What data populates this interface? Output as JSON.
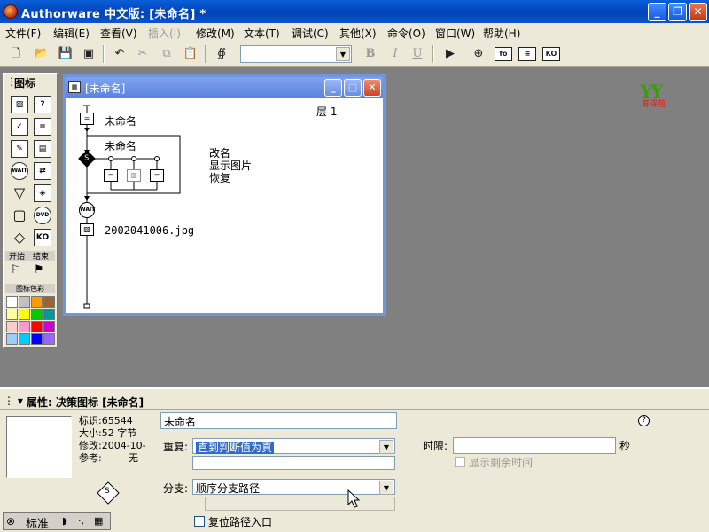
{
  "window": {
    "title": "Authorware 中文版: [未命名] *"
  },
  "menu": [
    "文件(F)",
    "编辑(E)",
    "查看(V)",
    "插入(I)",
    "修改(M)",
    "文本(T)",
    "调试(C)",
    "其他(X)",
    "命令(O)",
    "窗口(W)",
    "帮助(H)"
  ],
  "toolbar": {
    "font_value": "",
    "bold": "B",
    "italic": "I",
    "underline": "U",
    "logo_text": "YY",
    "logo_sub": "育碟苑"
  },
  "palette": {
    "title": "图标",
    "icons": [
      {
        "name": "display-icon",
        "glyph": "▨"
      },
      {
        "name": "motion-icon",
        "glyph": "?"
      },
      {
        "name": "erase-icon",
        "glyph": "✓"
      },
      {
        "name": "wait-icon",
        "glyph": "="
      },
      {
        "name": "navigate-icon",
        "glyph": "✎"
      },
      {
        "name": "framework-icon",
        "glyph": "▤"
      },
      {
        "name": "decision-icon",
        "glyph": "WAIT"
      },
      {
        "name": "interaction-icon",
        "glyph": "⇄"
      },
      {
        "name": "calculation-icon",
        "glyph": "▽"
      },
      {
        "name": "map-icon",
        "glyph": "◈"
      },
      {
        "name": "digital-movie-icon",
        "glyph": "▢"
      },
      {
        "name": "sound-icon",
        "glyph": "DVD"
      },
      {
        "name": "video-icon",
        "glyph": "◇"
      },
      {
        "name": "knowledge-object-icon",
        "glyph": "KO"
      }
    ],
    "start_label": "开始",
    "end_label": "结束",
    "color_title": "图标色彩",
    "colors": [
      "#ffffff",
      "#c0c0c0",
      "#ff9900",
      "#996633",
      "#ffff99",
      "#ffff00",
      "#00cc00",
      "#009999",
      "#ffcccc",
      "#ff99cc",
      "#ff0000",
      "#cc00cc",
      "#99ccff",
      "#00ccff",
      "#0000ff",
      "#9966ff"
    ]
  },
  "design_window": {
    "title": "[未命名]",
    "level": "层 1",
    "top_label": "未命名",
    "decision_label": "未命名",
    "branches": [
      "改名",
      "显示图片",
      "恢复"
    ],
    "image_label": "2002041006.jpg",
    "wait_text": "WAIT"
  },
  "properties": {
    "header": "属性: 决策图标 [未命名]",
    "id_label": "标识:65544",
    "size_label": "大小:52 字节",
    "modified_label": "修改:2004-10-",
    "ref_label": "参考:",
    "ref_value": "无",
    "name_value": "未命名",
    "repeat_label": "重复:",
    "repeat_value": "直到判断值为真",
    "time_label": "时限:",
    "time_unit": "秒",
    "show_remaining_label": "显示剩余时间",
    "branch_label": "分支:",
    "branch_value": "顺序分支路径",
    "reset_path_label": "复位路径入口",
    "help": "?",
    "status_text": "标准"
  }
}
